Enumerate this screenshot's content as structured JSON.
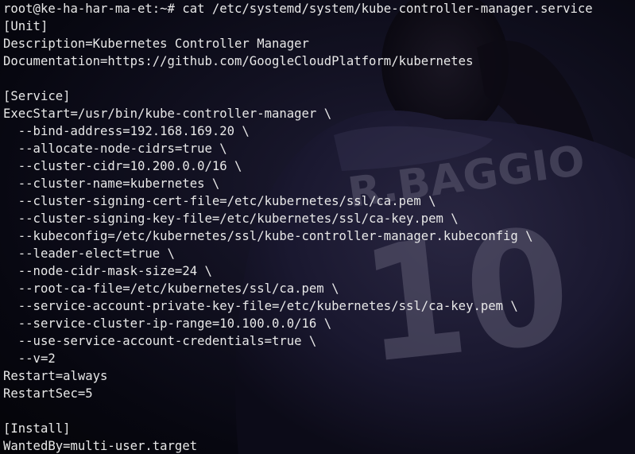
{
  "background": {
    "image_lettering": "R.BAGGIO",
    "image_number": "10",
    "accent_color": "#5e5b72"
  },
  "terminal": {
    "text_color": "#e8e8e8",
    "lines": [
      "root@ke-ha-har-ma-et:~# cat /etc/systemd/system/kube-controller-manager.service",
      "[Unit]",
      "Description=Kubernetes Controller Manager",
      "Documentation=https://github.com/GoogleCloudPlatform/kubernetes",
      "",
      "[Service]",
      "ExecStart=/usr/bin/kube-controller-manager \\",
      "  --bind-address=192.168.169.20 \\",
      "  --allocate-node-cidrs=true \\",
      "  --cluster-cidr=10.200.0.0/16 \\",
      "  --cluster-name=kubernetes \\",
      "  --cluster-signing-cert-file=/etc/kubernetes/ssl/ca.pem \\",
      "  --cluster-signing-key-file=/etc/kubernetes/ssl/ca-key.pem \\",
      "  --kubeconfig=/etc/kubernetes/ssl/kube-controller-manager.kubeconfig \\",
      "  --leader-elect=true \\",
      "  --node-cidr-mask-size=24 \\",
      "  --root-ca-file=/etc/kubernetes/ssl/ca.pem \\",
      "  --service-account-private-key-file=/etc/kubernetes/ssl/ca-key.pem \\",
      "  --service-cluster-ip-range=10.100.0.0/16 \\",
      "  --use-service-account-credentials=true \\",
      "  --v=2",
      "Restart=always",
      "RestartSec=5",
      "",
      "[Install]",
      "WantedBy=multi-user.target"
    ]
  }
}
